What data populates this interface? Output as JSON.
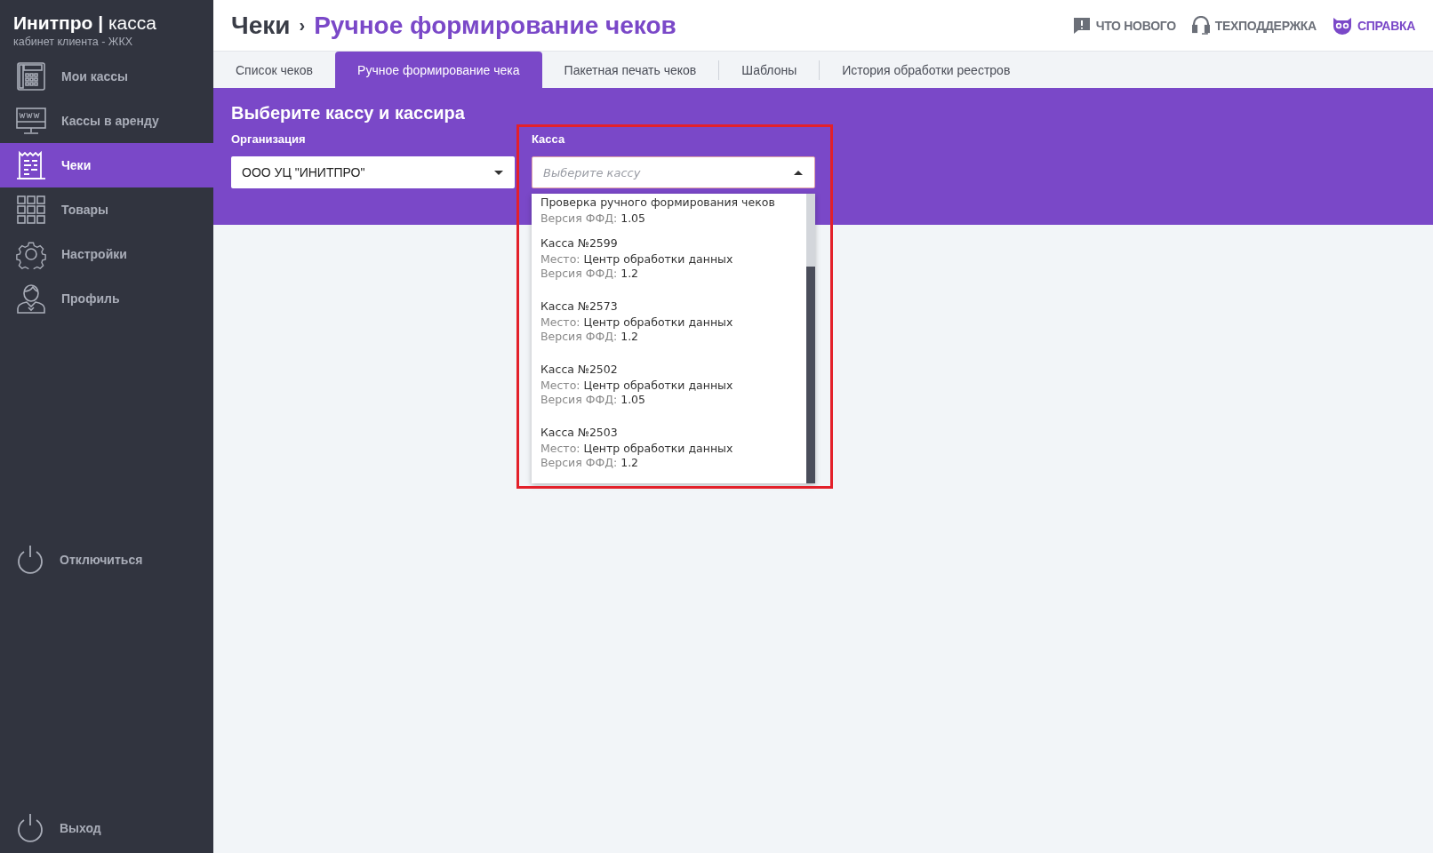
{
  "brand": {
    "name": "Инитпро",
    "separator": "|",
    "product": "касса",
    "subtitle": "кабинет клиента - ЖКХ"
  },
  "sidebar": {
    "items": [
      {
        "label": "Мои кассы",
        "kind": "register",
        "selected": false
      },
      {
        "label": "Кассы в аренду",
        "kind": "monitor",
        "selected": false
      },
      {
        "label": "Чеки",
        "kind": "receipt",
        "selected": true
      },
      {
        "label": "Товары",
        "kind": "grid",
        "selected": false
      },
      {
        "label": "Настройки",
        "kind": "gear",
        "selected": false
      },
      {
        "label": "Профиль",
        "kind": "user",
        "selected": false
      }
    ],
    "bottom_items": [
      {
        "label": "Отключиться",
        "kind": "power"
      },
      {
        "label": "Выход",
        "kind": "power"
      }
    ]
  },
  "breadcrumb": {
    "parent": "Чеки",
    "separator": "›",
    "current": "Ручное формирование чеков"
  },
  "header_links": [
    {
      "label": "ЧТО НОВОГО",
      "kind": "news"
    },
    {
      "label": "ТЕХПОДДЕРЖКА",
      "kind": "support"
    },
    {
      "label": "СПРАВКА",
      "kind": "help"
    }
  ],
  "tabs": [
    {
      "label": "Список чеков",
      "selected": false
    },
    {
      "label": "Ручное формирование чека",
      "selected": true
    },
    {
      "label": "Пакетная печать чеков",
      "selected": false
    },
    {
      "label": "Шаблоны",
      "selected": false
    },
    {
      "label": "История обработки реестров",
      "selected": false
    }
  ],
  "form": {
    "title": "Выберите кассу и кассира",
    "organization": {
      "label": "Организация",
      "value": "ООО УЦ \"ИНИТПРО\""
    },
    "register": {
      "label": "Касса",
      "placeholder": "Выберите кассу",
      "expanded": true,
      "options": [
        {
          "name": "Проверка ручного формирования чеков",
          "version_label": "Версия ФФД:",
          "version": "1.05"
        },
        {
          "name": "Касса №2599",
          "place_label": "Место:",
          "place": "Центр обработки данных",
          "version_label": "Версия ФФД:",
          "version": "1.2"
        },
        {
          "name": "Касса №2573",
          "place_label": "Место:",
          "place": "Центр обработки данных",
          "version_label": "Версия ФФД:",
          "version": "1.2"
        },
        {
          "name": "Касса №2502",
          "place_label": "Место:",
          "place": "Центр обработки данных",
          "version_label": "Версия ФФД:",
          "version": "1.05"
        },
        {
          "name": "Касса №2503",
          "place_label": "Место:",
          "place": "Центр обработки данных",
          "version_label": "Версия ФФД:",
          "version": "1.2"
        }
      ]
    }
  }
}
